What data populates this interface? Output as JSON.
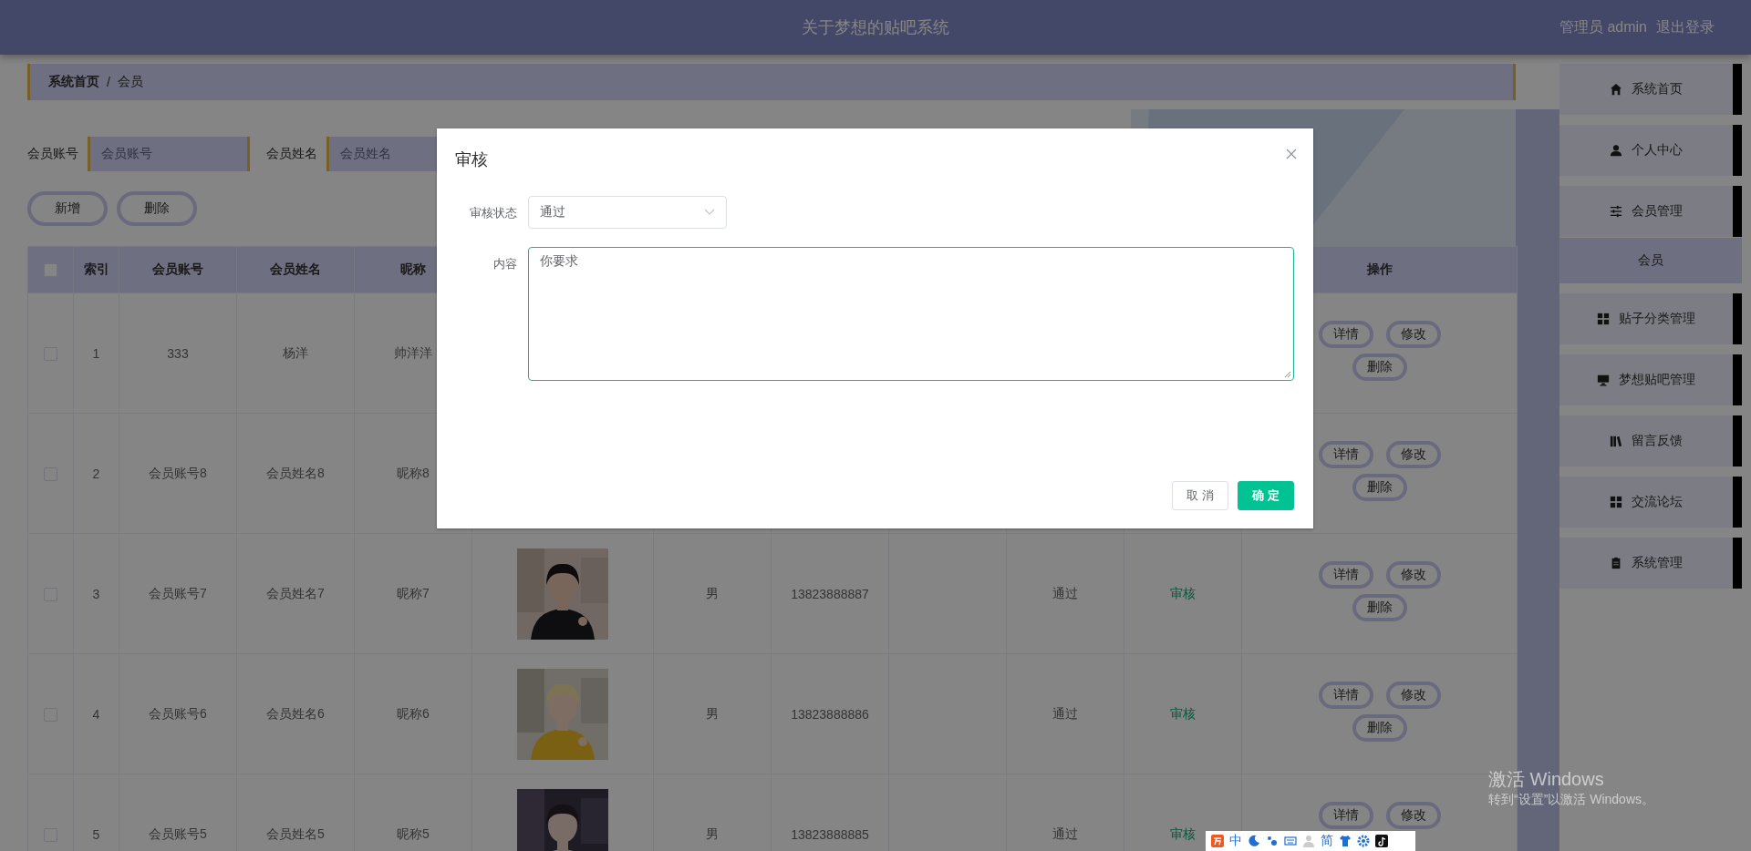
{
  "header": {
    "title": "关于梦想的贴吧系统",
    "user_label": "管理员 admin",
    "logout": "退出登录"
  },
  "breadcrumb": {
    "separator": "/",
    "items": [
      {
        "label": "系统首页"
      },
      {
        "label": "会员"
      }
    ]
  },
  "search": [
    {
      "label": "会员账号",
      "placeholder": "会员账号"
    },
    {
      "label": "会员姓名",
      "placeholder": "会员姓名"
    }
  ],
  "actions": [
    "新增",
    "删除"
  ],
  "table": {
    "select_all_checked": false,
    "columns": [
      "索引",
      "会员账号",
      "会员姓名",
      "昵称",
      "操作"
    ],
    "rows": [
      {
        "checked": false,
        "index": "1",
        "account": "333",
        "name": "杨洋",
        "nickname": "帅洋洋",
        "actions": [
          "详情",
          "修改",
          "删除"
        ]
      },
      {
        "checked": false,
        "index": "2",
        "account": "会员账号8",
        "name": "会员姓名8",
        "nickname": "昵称8",
        "actions": [
          "详情",
          "修改",
          "删除"
        ]
      },
      {
        "checked": false,
        "index": "3",
        "account": "会员账号7",
        "name": "会员姓名7",
        "nickname": "昵称7",
        "avatar": {
          "kind": "picture"
        },
        "sex": "男",
        "phone": "13823888887",
        "status": "通过",
        "review": "审核",
        "actions": [
          "详情",
          "修改",
          "删除"
        ]
      },
      {
        "checked": false,
        "index": "4",
        "account": "会员账号6",
        "name": "会员姓名6",
        "nickname": "昵称6",
        "avatar": {
          "kind": "picture"
        },
        "sex": "男",
        "phone": "13823888886",
        "status": "通过",
        "review": "审核",
        "actions": [
          "详情",
          "修改",
          "删除"
        ]
      },
      {
        "checked": false,
        "index": "5",
        "account": "会员账号5",
        "name": "会员姓名5",
        "nickname": "昵称5",
        "avatar": {
          "kind": "picture"
        },
        "sex": "男",
        "phone": "13823888885",
        "status": "通过",
        "review": "审核",
        "actions": [
          "详情",
          "修改"
        ]
      }
    ]
  },
  "sidebar": {
    "items": [
      {
        "label": "系统首页"
      },
      {
        "label": "个人中心"
      },
      {
        "label": "会员管理",
        "children": [
          {
            "label": "会员",
            "selected": true
          }
        ]
      },
      {
        "label": "贴子分类管理"
      },
      {
        "label": "梦想贴吧管理"
      },
      {
        "label": "留言反馈"
      },
      {
        "label": "交流论坛"
      },
      {
        "label": "系统管理"
      }
    ]
  },
  "dialog": {
    "title": "审核",
    "fields": [
      {
        "kind": "select",
        "label": "审核状态",
        "value": "通过"
      },
      {
        "kind": "textarea",
        "label": "内容",
        "value": "你要求",
        "focused": true
      }
    ],
    "buttons": [
      {
        "kind": "default",
        "label": "取 消"
      },
      {
        "kind": "primary",
        "label": "确 定"
      }
    ]
  },
  "os_notice": {
    "title": "激活 Windows",
    "text": "转到“设置”以激活 Windows。"
  },
  "ime_toolbar": {
    "mode": "中",
    "charset": "简"
  }
}
